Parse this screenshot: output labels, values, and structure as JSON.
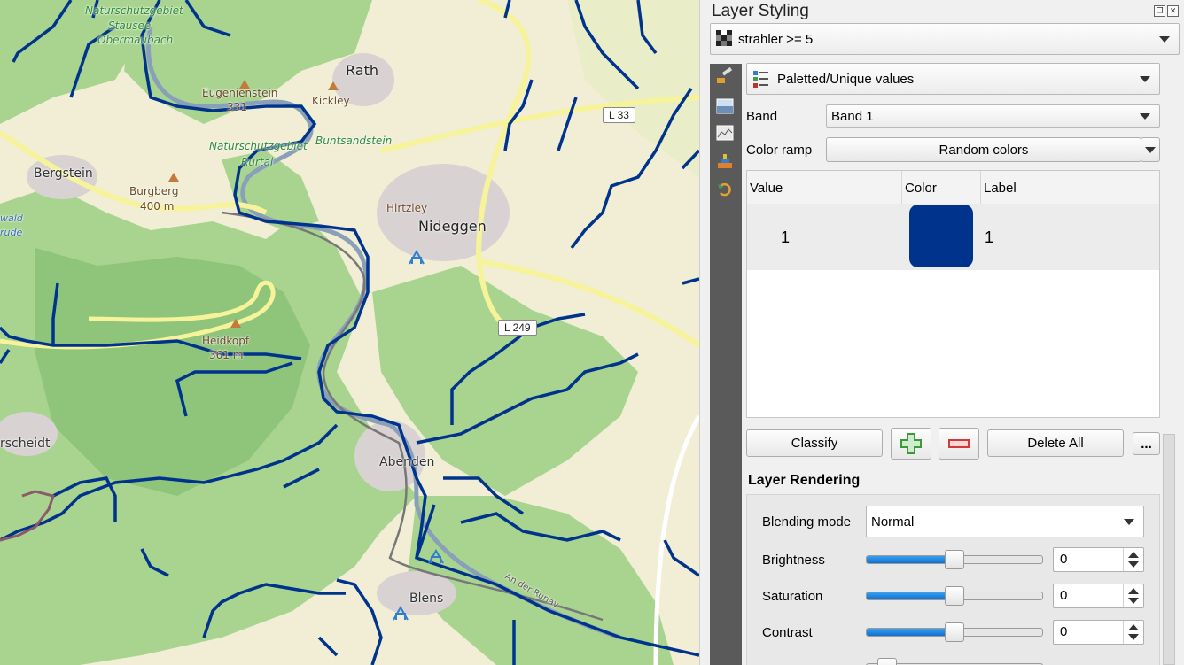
{
  "panel": {
    "title": "Layer Styling",
    "layer_name": "strahler >= 5",
    "renderer": "Paletted/Unique values",
    "band_label": "Band",
    "band_value": "Band 1",
    "color_ramp_label": "Color ramp",
    "color_ramp_value": "Random colors",
    "table": {
      "headers": [
        "Value",
        "Color",
        "Label"
      ],
      "rows": [
        {
          "value": "1",
          "color": "#00338c",
          "label": "1"
        }
      ]
    },
    "buttons": {
      "classify": "Classify",
      "delete_all": "Delete All",
      "more": "..."
    },
    "layer_rendering": {
      "title": "Layer Rendering",
      "blending_label": "Blending mode",
      "blending_value": "Normal",
      "brightness_label": "Brightness",
      "brightness_value": "0",
      "saturation_label": "Saturation",
      "saturation_value": "0",
      "contrast_label": "Contrast",
      "contrast_value": "0",
      "slider_level": 0.5
    }
  },
  "map": {
    "labels": {
      "naturschutz1": "Naturschutzgebiet",
      "stausee": "Stausee",
      "obermaubach": "Obermaubach",
      "rath": "Rath",
      "eugenienstein": "Eugenienstein",
      "eugen_elev": "331",
      "kickley": "Kickley",
      "naturschutz2": "Naturschutzgebiet",
      "buntsandstein": "Buntsandstein",
      "rurtal": "Rurtal",
      "bergstein": "Bergstein",
      "burgberg": "Burgberg",
      "burgberg_elev": "400 m",
      "hirtzley": "Hirtzley",
      "nideggen": "Nideggen",
      "l33": "L 33",
      "heidkopf": "Heidkopf",
      "heidkopf_elev": "361 m",
      "l249": "L 249",
      "scheidt": "rscheidt",
      "abenden": "Abenden",
      "blens": "Blens",
      "anderrurlay": "An der Rurlay",
      "wald": "wald",
      "rude": "rude"
    },
    "colors": {
      "stream": "#00338c",
      "forest": "#a8d48f",
      "forest_dark": "#8fc47b",
      "farmland": "#f1eed5",
      "road": "#f6f39b"
    }
  }
}
